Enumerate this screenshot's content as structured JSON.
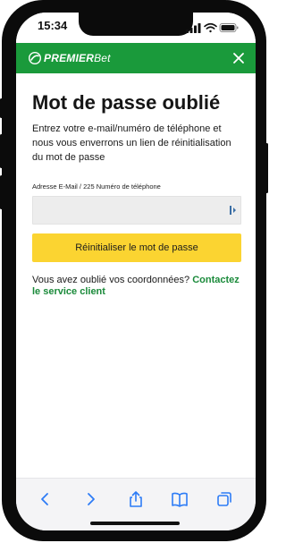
{
  "status_bar": {
    "time": "15:34"
  },
  "header": {
    "logo_brand": "PREMIER",
    "logo_suffix": "Bet",
    "brand_color": "#1a9a3b",
    "close_icon": "close-icon"
  },
  "page": {
    "title": "Mot de passe oublié",
    "description": "Entrez votre e-mail/numéro de téléphone et nous vous enverrons un lien de réinitialisation du mot de passe",
    "field_label": "Adresse E-Mail / 225 Numéro de téléphone",
    "field_value": "",
    "submit_label": "Réinitialiser le mot de passe",
    "submit_color": "#fbd431",
    "help_text": "Vous avez oublié vos coordonnées?",
    "help_link": "Contactez le service client",
    "link_color": "#1a8a3a"
  },
  "browser_toolbar": {
    "items": [
      "back-icon",
      "forward-icon",
      "share-icon",
      "bookmarks-icon",
      "tabs-icon"
    ]
  }
}
